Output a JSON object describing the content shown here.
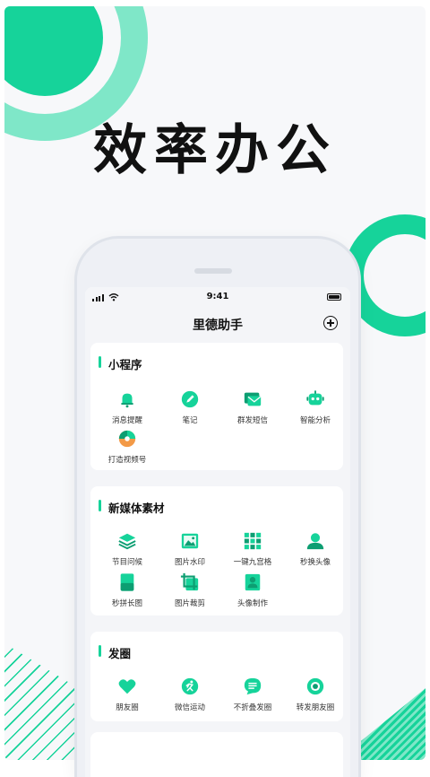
{
  "hero": {
    "title": "效率办公"
  },
  "colors": {
    "accent": "#16d39a",
    "accent_light": "#7fe7c8"
  },
  "phone": {
    "status_time": "9:41",
    "app_title": "里德助手",
    "add_icon": "plus-circle-icon"
  },
  "sections": [
    {
      "title": "小程序",
      "items": [
        {
          "label": "消息提醒",
          "icon": "bell-icon"
        },
        {
          "label": "笔记",
          "icon": "pen-icon"
        },
        {
          "label": "群发短信",
          "icon": "envelope-icon"
        },
        {
          "label": "智能分析",
          "icon": "robot-icon"
        },
        {
          "label": "打造视频号",
          "icon": "video-flower-icon"
        }
      ]
    },
    {
      "title": "新媒体素材",
      "items": [
        {
          "label": "节目问候",
          "icon": "layers-icon"
        },
        {
          "label": "图片水印",
          "icon": "image-icon"
        },
        {
          "label": "一键九宫格",
          "icon": "grid-icon"
        },
        {
          "label": "秒换头像",
          "icon": "avatar-icon"
        },
        {
          "label": "秒拼长图",
          "icon": "long-image-icon"
        },
        {
          "label": "图片裁剪",
          "icon": "crop-icon"
        },
        {
          "label": "头像制作",
          "icon": "avatar-maker-icon"
        }
      ]
    },
    {
      "title": "发圈",
      "items": [
        {
          "label": "朋友圈",
          "icon": "heart-icon"
        },
        {
          "label": "微信运动",
          "icon": "run-icon"
        },
        {
          "label": "不折叠发圈",
          "icon": "chat-lines-icon"
        },
        {
          "label": "转发朋友圈",
          "icon": "aperture-icon"
        }
      ]
    }
  ]
}
